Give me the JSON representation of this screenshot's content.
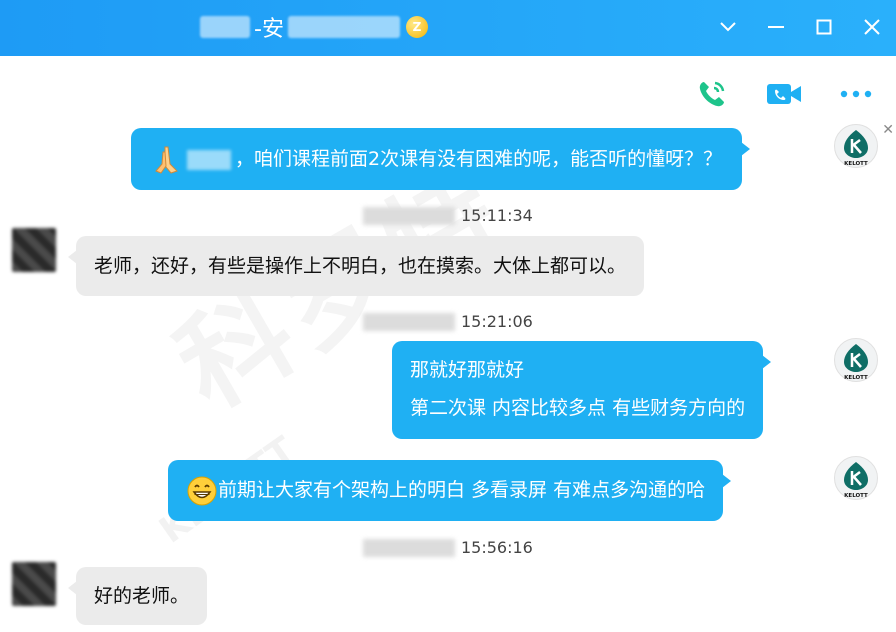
{
  "window": {
    "title_fragment": "-安",
    "vip_level": "Z"
  },
  "messages": [
    {
      "side": "mine",
      "prefix_icon": "pray-hands-icon",
      "text": "，咱们课程前面2次课有没有困难的呢，能否听的懂呀？？"
    },
    {
      "side": "time",
      "text": "15:11:34"
    },
    {
      "side": "peer",
      "text": "老师，还好，有些是操作上不明白，也在摸索。大体上都可以。"
    },
    {
      "side": "time",
      "text": "15:21:06"
    },
    {
      "side": "mine",
      "lines": [
        "那就好那就好",
        "第二次课 内容比较多点 有些财务方向的"
      ]
    },
    {
      "side": "mine",
      "prefix_icon": "grin-emoji-icon",
      "text": "前期让大家有个架构上的明白  多看录屏 有难点多沟通的哈"
    },
    {
      "side": "time",
      "text": "15:56:16"
    },
    {
      "side": "peer",
      "text": "好的老师。"
    }
  ],
  "avatar_text": "KELOTT",
  "watermark_text": "科罗特",
  "watermark_sub": "KELOTT",
  "colors": {
    "titlebar": "#2ab0fb",
    "bubble_mine": "#1fb0f3",
    "bubble_peer": "#ebebeb",
    "call_green": "#1ec48b",
    "video_blue": "#1fb0f3"
  }
}
